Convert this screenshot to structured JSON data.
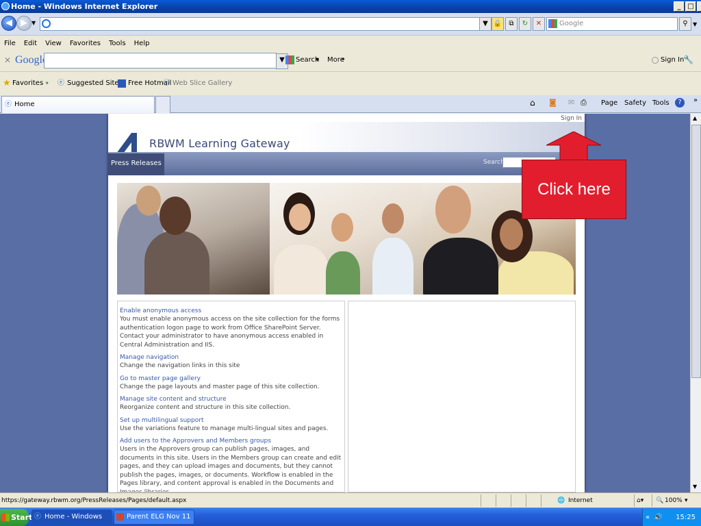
{
  "window": {
    "title": "Home - Windows Internet Explorer"
  },
  "address_bar": {
    "url": "",
    "search_placeholder": "Google"
  },
  "menu": [
    "File",
    "Edit",
    "View",
    "Favorites",
    "Tools",
    "Help"
  ],
  "google_toolbar": {
    "logo": "Google",
    "search_label": "Search",
    "more_label": "More",
    "sign_in_label": "Sign In"
  },
  "favorites_bar": {
    "favorites_label": "Favorites",
    "items": [
      "Suggested Sites",
      "Free Hotmail",
      "Web Slice Gallery"
    ]
  },
  "tabs": {
    "active": "Home"
  },
  "command_bar": {
    "page_label": "Page",
    "safety_label": "Safety",
    "tools_label": "Tools"
  },
  "site": {
    "title": "RBWM Learning Gateway",
    "sign_in": "Sign In",
    "nav_item": "Press Releases",
    "search_label": "Search",
    "tasks": [
      {
        "link": "Enable anonymous access",
        "desc": "You must enable anonymous access on the site collection for the forms authentication logon page to work from Office SharePoint Server. Contact your administrator to have anonymous access enabled in Central Administration and IIS."
      },
      {
        "link": "Manage navigation",
        "desc": "Change the navigation links in this site"
      },
      {
        "link": "Go to master page gallery",
        "desc": "Change the page layouts and master page of this site collection."
      },
      {
        "link": "Manage site content and structure",
        "desc": "Reorganize content and structure in this site collection."
      },
      {
        "link": "Set up multilingual support",
        "desc": "Use the variations feature to manage multi-lingual sites and pages."
      },
      {
        "link": "Add users to the Approvers and Members groups",
        "desc": "Users in the Approvers group can publish pages, images, and documents in this site. Users in the Members group can create and edit pages, and they can upload images and documents, but they cannot publish the pages, images, or documents. Workflow is enabled in the Pages library, and content approval is enabled in the Documents and Images libraries."
      }
    ]
  },
  "callout": {
    "text": "Click here",
    "color": "#e21e2e"
  },
  "status_bar": {
    "url": "https://gateway.rbwm.org/PressReleases/Pages/default.aspx",
    "zone": "Internet",
    "zoom": "100%"
  },
  "taskbar": {
    "start": "Start",
    "items": [
      "Home - Windows Inte...",
      "Parent ELG Nov 11"
    ],
    "clock": "15:25"
  }
}
